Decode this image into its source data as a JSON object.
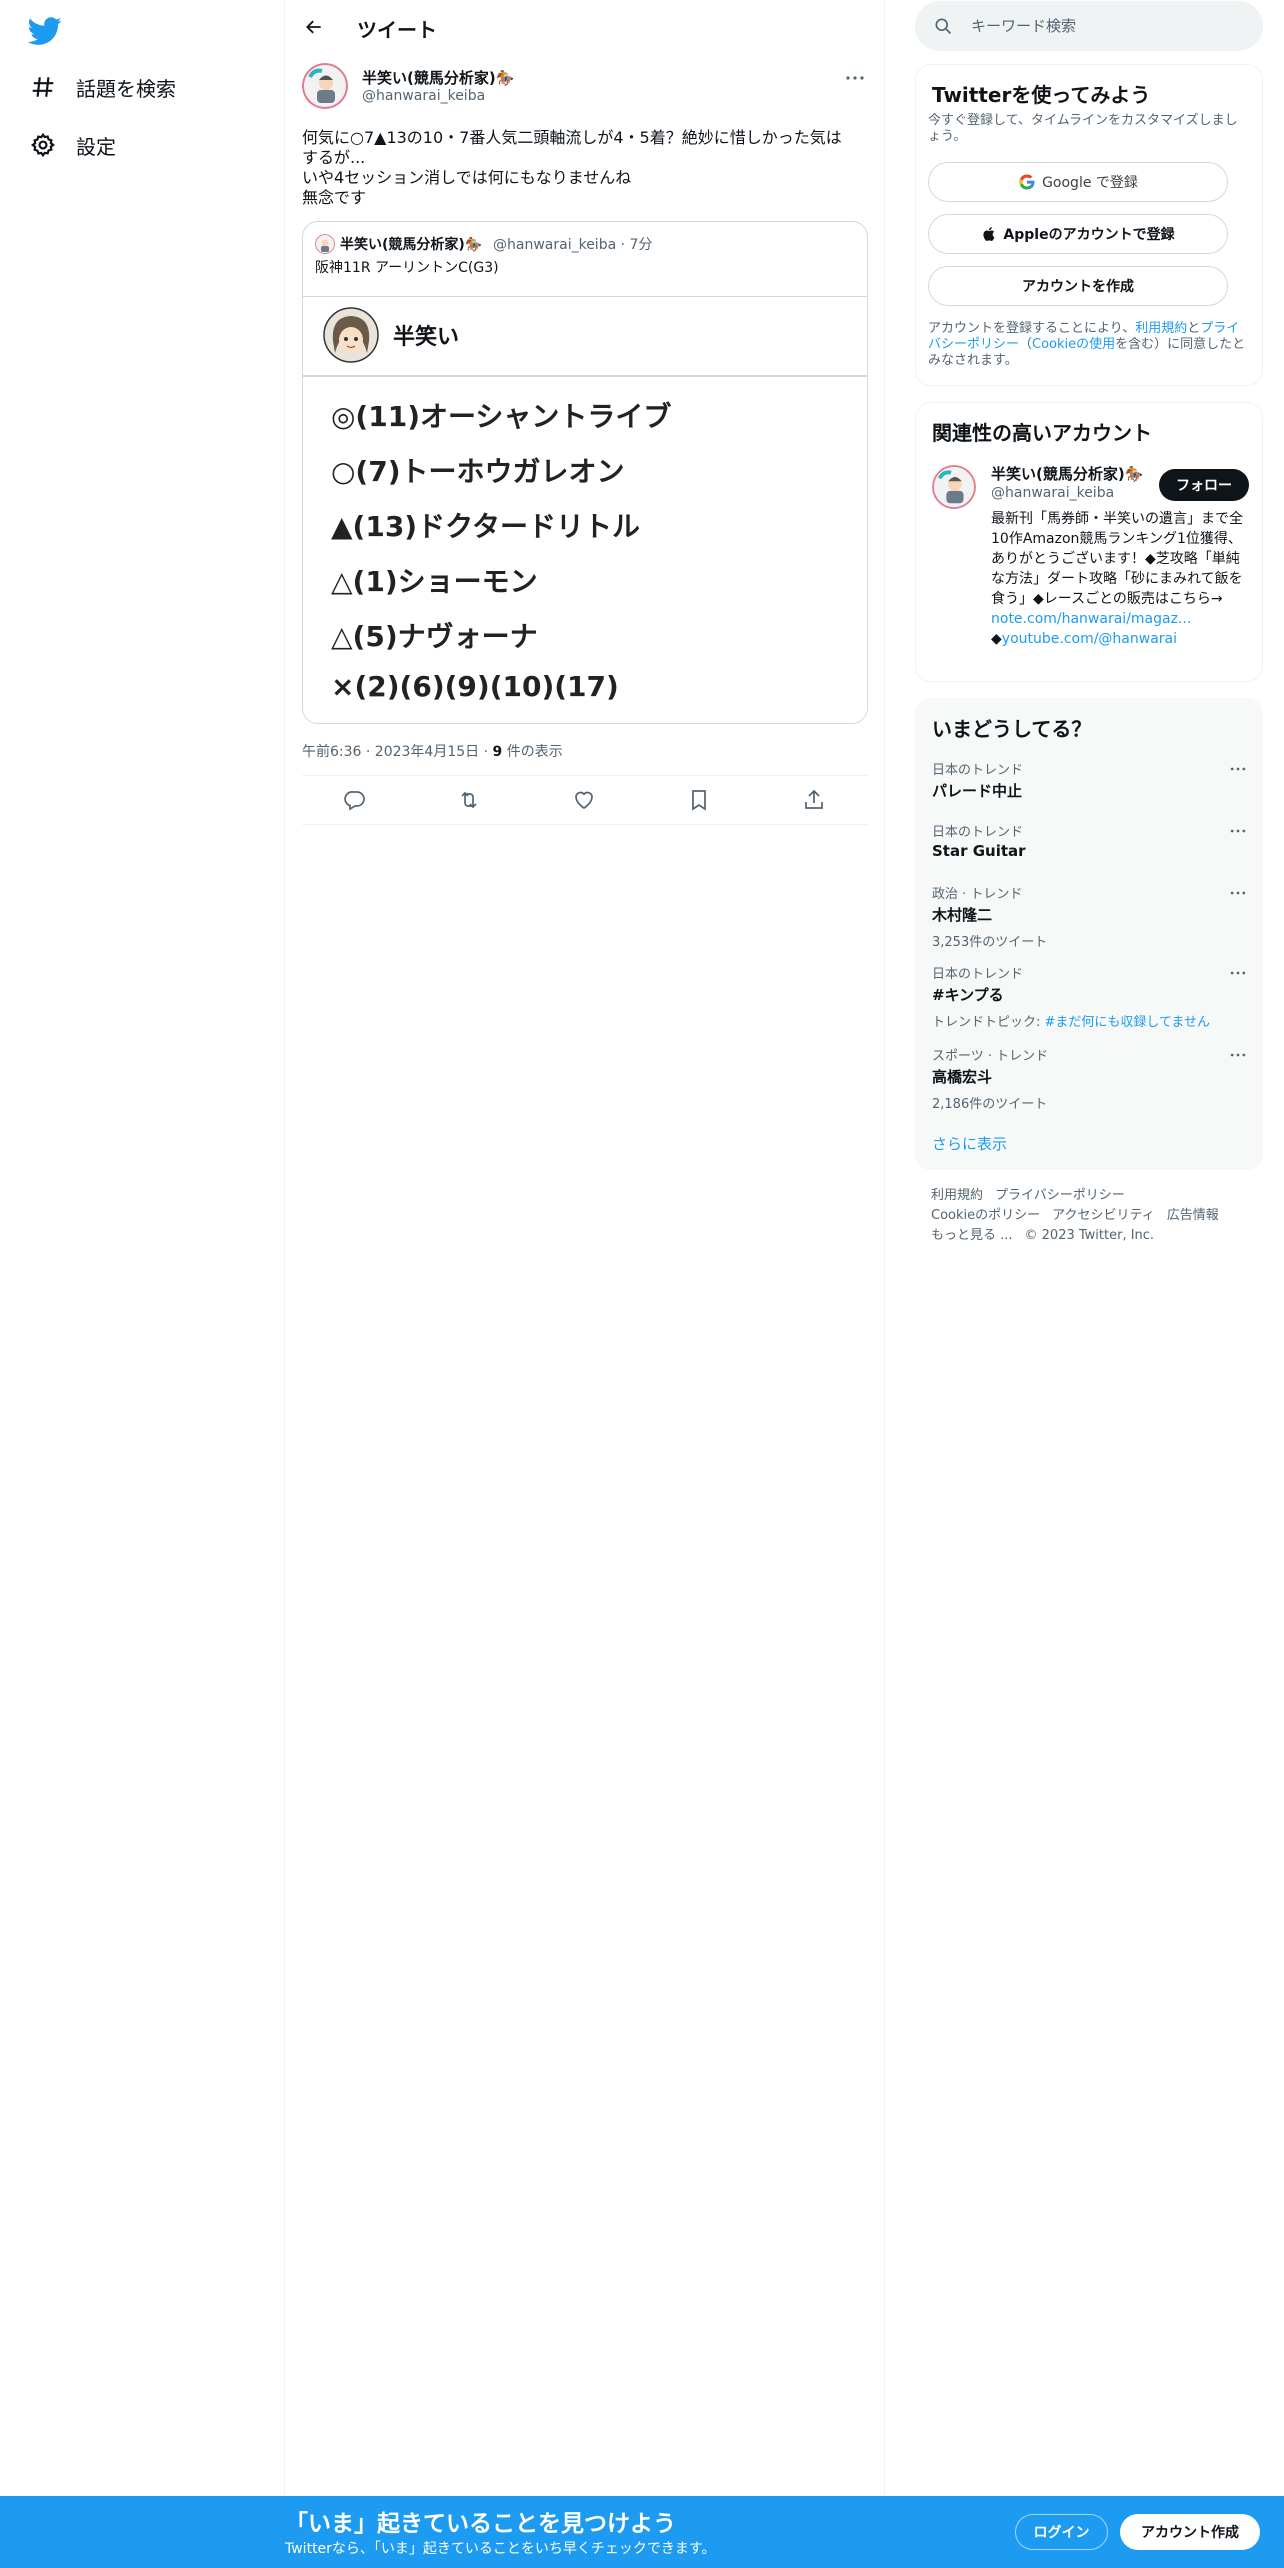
{
  "nav": {
    "logo": "twitter-bird-icon",
    "items": [
      {
        "label": "話題を検索",
        "icon": "hashtag-icon"
      },
      {
        "label": "設定",
        "icon": "gear-icon"
      }
    ]
  },
  "header": {
    "title": "ツイート"
  },
  "tweet": {
    "author_name": "半笑い(競馬分析家)🏇",
    "author_handle": "@hanwarai_keiba",
    "text_lines": [
      "何気に○7▲13の10・7番人気二頭軸流しが4・5着？絶妙に惜しかった気は",
      "するが...",
      "いや4セッション消しでは何にもなりませんね",
      "無念です"
    ],
    "quote": {
      "author_name": "半笑い(競馬分析家)🏇",
      "meta": "@hanwarai_keiba · 7分",
      "text": "阪神11R アーリントンC(G3)",
      "image": {
        "name": "半笑い",
        "picks": [
          "◎(11)オーシャントライブ",
          "○(7)トーホウガレオン",
          "▲(13)ドクタードリトル",
          "△(1)ショーモン",
          "△(5)ナヴォーナ",
          "×(2)(6)(9)(10)(17)"
        ]
      }
    },
    "timestamp_pre": "午前6:36 · 2023年4月15日 · ",
    "views_count": "9",
    "views_label": " 件の表示"
  },
  "search": {
    "placeholder": "キーワード検索"
  },
  "signup_card": {
    "title": "Twitterを使ってみよう",
    "subtitle": "今すぐ登録して、タイムラインをカスタマイズしましょう。",
    "google_label": "Google で登録",
    "apple_label": "Appleのアカウントで登録",
    "create_label": "アカウントを作成",
    "note_pre": "アカウントを登録することにより、",
    "note_terms": "利用規約",
    "note_and": "と",
    "note_privacy": "プライバシーポリシー",
    "note_paren_open": "（",
    "note_cookie": "Cookieの使用",
    "note_post": "を含む）に同意したとみなされます。"
  },
  "related_card": {
    "title": "関連性の高いアカウント",
    "name": "半笑い(競馬分析家)🏇",
    "handle": "@hanwarai_keiba",
    "follow_label": "フォロー",
    "bio": "最新刊「馬券師・半笑いの遺言」まで全10作Amazon競馬ランキング1位獲得、ありがとうございます！◆芝攻略「単純な方法」ダート攻略「砂にまみれて飯を食う」◆レースごとの販売はこちら→",
    "link1": "note.com/hanwarai/magaz...",
    "link2_prefix": "◆",
    "link2": "youtube.com/@hanwarai"
  },
  "trends_card": {
    "title": "いまどうしてる？",
    "items": [
      {
        "category": "日本のトレンド",
        "name": "パレード中止",
        "count": ""
      },
      {
        "category": "日本のトレンド",
        "name": "Star Guitar",
        "count": ""
      },
      {
        "category": "政治 · トレンド",
        "name": "木村隆二",
        "count": "3,253件のツイート"
      },
      {
        "category": "日本のトレンド",
        "name": "#キンプる",
        "count_prefix": "トレンドトピック: ",
        "count_link": "#まだ何にも収録してません"
      },
      {
        "category": "スポーツ · トレンド",
        "name": "高橋宏斗",
        "count": "2,186件のツイート"
      }
    ],
    "show_more": "さらに表示"
  },
  "footer": {
    "links": [
      "利用規約",
      "プライバシーポリシー",
      "Cookieのポリシー",
      "アクセシビリティ",
      "広告情報",
      "もっと見る ..."
    ],
    "copyright": "© 2023 Twitter, Inc."
  },
  "banner": {
    "title": "「いま」起きていることを見つけよう",
    "subtitle": "Twitterなら、「いま」起きていることをいち早くチェックできます。",
    "login": "ログイン",
    "signup": "アカウント作成"
  },
  "colors": {
    "accent": "#1d9bf0",
    "text": "#0f1419",
    "secondary": "#536471",
    "border": "#eff3f4"
  }
}
